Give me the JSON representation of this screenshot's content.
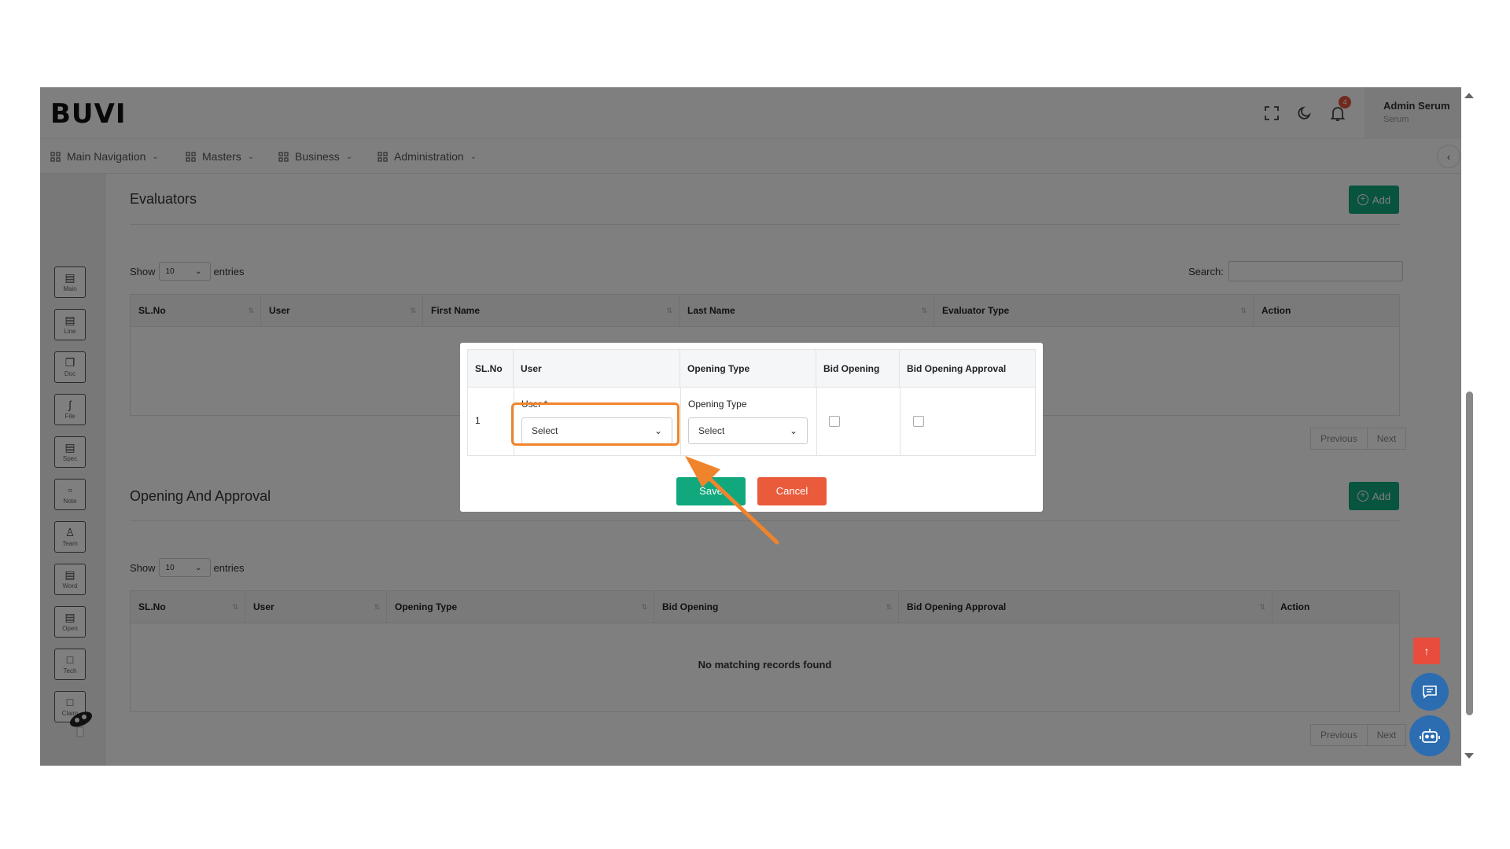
{
  "header": {
    "logo": "BUVI",
    "notification_count": "4",
    "user_name": "Admin Serum",
    "user_sub": "Serum"
  },
  "nav": {
    "items": [
      {
        "label": "Main Navigation"
      },
      {
        "label": "Masters"
      },
      {
        "label": "Business"
      },
      {
        "label": "Administration"
      }
    ]
  },
  "sidebar": {
    "items": [
      {
        "label": "Main",
        "icon": "document-icon"
      },
      {
        "label": "Line",
        "icon": "document-icon"
      },
      {
        "label": "Doc",
        "icon": "copy-icon"
      },
      {
        "label": "File",
        "icon": "paperclip-icon"
      },
      {
        "label": "Spec",
        "icon": "document-icon"
      },
      {
        "label": "Note",
        "icon": "note-icon"
      },
      {
        "label": "Team",
        "icon": "team-icon"
      },
      {
        "label": "Word",
        "icon": "document-icon"
      },
      {
        "label": "Open",
        "icon": "document-icon"
      },
      {
        "label": "Tech",
        "icon": "chat-icon"
      },
      {
        "label": "Claim",
        "icon": "chat-icon"
      }
    ]
  },
  "evaluators": {
    "title": "Evaluators",
    "add_label": "Add",
    "show_label": "Show",
    "page_length": "10",
    "entries_label": "entries",
    "search_label": "Search:",
    "columns": [
      "SL.No",
      "User",
      "First Name",
      "Last Name",
      "Evaluator Type",
      "Action"
    ],
    "previous_label": "Previous",
    "next_label": "Next"
  },
  "opening": {
    "title": "Opening And Approval",
    "add_label": "Add",
    "show_label": "Show",
    "page_length": "10",
    "entries_label": "entries",
    "columns": [
      "SL.No",
      "User",
      "Opening Type",
      "Bid Opening",
      "Bid Opening Approval",
      "Action"
    ],
    "empty_message": "No matching records found",
    "previous_label": "Previous",
    "next_label": "Next"
  },
  "modal": {
    "columns": [
      "SL.No",
      "User",
      "Opening Type",
      "Bid Opening",
      "Bid Opening Approval"
    ],
    "row_number": "1",
    "user_label": "User *",
    "user_value": "Select",
    "opening_type_label": "Opening Type",
    "opening_type_value": "Select",
    "save_label": "Save",
    "cancel_label": "Cancel"
  },
  "colors": {
    "accent_green": "#12a87e",
    "cancel_red": "#ea5b3c",
    "highlight_orange": "#f0842c",
    "float_blue": "#2c6db1"
  }
}
